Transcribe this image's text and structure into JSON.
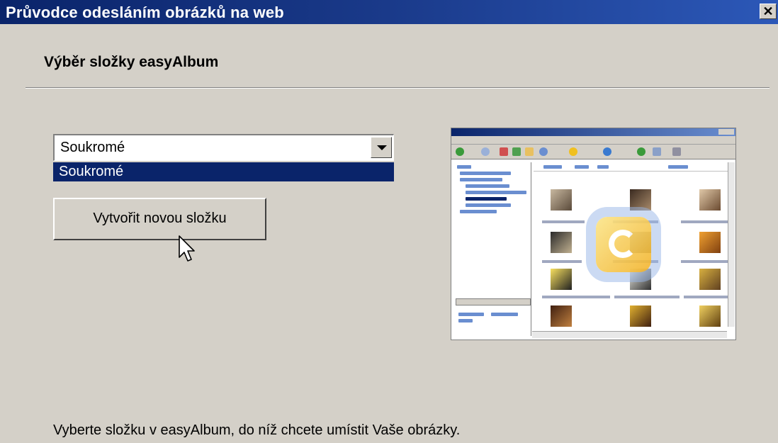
{
  "window": {
    "title": "Průvodce odesláním obrázků na web",
    "close_label": "✕"
  },
  "page": {
    "heading": "Výběr složky easyAlbum"
  },
  "folder_combo": {
    "selected_value": "Soukromé",
    "dropdown_items": [
      "Soukromé"
    ]
  },
  "buttons": {
    "new_folder_label": "Vytvořit novou složku"
  },
  "footer": {
    "instruction": "Vyberte složku v easyAlbum, do níž chcete umístit Vaše obrázky."
  },
  "colors": {
    "titlebar": "#0a246a",
    "selection": "#0a246a",
    "dialog_bg": "#d4d0c8"
  },
  "icons": {
    "close": "close-icon",
    "dropdown": "chevron-down-icon",
    "cursor": "mouse-pointer-icon",
    "preview_logo": "easyalbum-logo-icon"
  }
}
